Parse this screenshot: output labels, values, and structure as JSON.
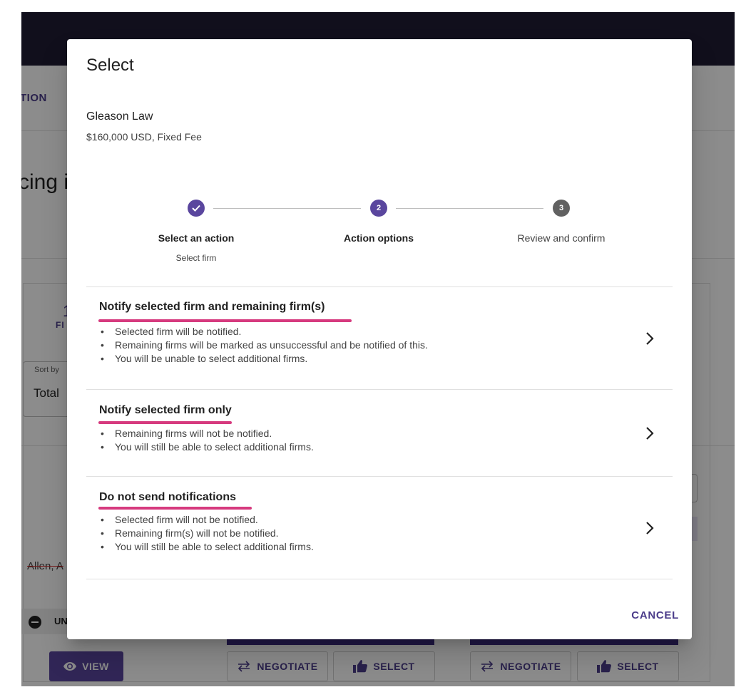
{
  "background": {
    "tab_label": "TION",
    "heading_fragment": "cing i",
    "stat_number": "1",
    "stat_label": "FI",
    "sort_label": "Sort by",
    "sort_value": "Total",
    "lawyer_name": "Allen, A",
    "unselected_chip": "UN",
    "view_button": "VIEW",
    "negotiate_button": "NEGOTIATE",
    "select_button": "SELECT"
  },
  "dialog": {
    "title": "Select",
    "firm_name": "Gleason Law",
    "firm_fee": "$160,000 USD, Fixed Fee",
    "steps": [
      {
        "number": "1",
        "label": "Select an action",
        "sublabel": "Select firm",
        "state": "completed"
      },
      {
        "number": "2",
        "label": "Action options",
        "sublabel": "",
        "state": "active"
      },
      {
        "number": "3",
        "label": "Review and confirm",
        "sublabel": "",
        "state": "pending"
      }
    ],
    "options": [
      {
        "title": "Notify selected firm and remaining firm(s)",
        "bullets": [
          "Selected firm will be notified.",
          "Remaining firms will be marked as unsuccessful and be notified of this.",
          "You will be unable to select additional firms."
        ]
      },
      {
        "title": "Notify selected firm only",
        "bullets": [
          "Remaining firms will not be notified.",
          "You will still be able to select additional firms."
        ]
      },
      {
        "title": "Do not send notifications",
        "bullets": [
          "Selected firm will not be notified.",
          "Remaining firm(s) will not be notified.",
          "You will still be able to select additional firms."
        ]
      }
    ],
    "cancel_label": "CANCEL"
  },
  "colors": {
    "primary": "#4b3c8a",
    "step_active": "#5a469e",
    "step_pending": "#616161",
    "highlight_underline": "#d63a7e",
    "topbar": "#1f1d33"
  },
  "icons": {
    "step_completed": "check-icon",
    "option_action": "chevron-right-icon",
    "view": "eye-icon",
    "negotiate": "swap-arrows-icon",
    "select": "thumbs-up-icon",
    "unselected": "minus-circle-icon"
  }
}
